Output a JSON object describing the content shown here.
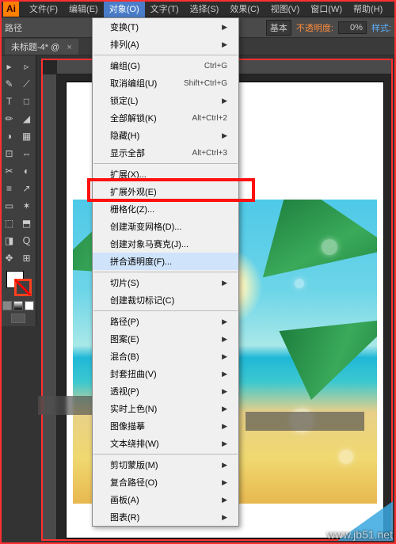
{
  "menubar": {
    "items": [
      "文件(F)",
      "编辑(E)",
      "对象(O)",
      "文字(T)",
      "选择(S)",
      "效果(C)",
      "视图(V)",
      "窗口(W)",
      "帮助(H)"
    ],
    "active_index": 2
  },
  "toolbar": {
    "path_label": "路径",
    "basic": "基本",
    "opacity_label": "不透明度:",
    "opacity_value": "0%",
    "style_label": "样式:"
  },
  "tab": {
    "title": "未标题-4*",
    "zoom": "@",
    "close": "×"
  },
  "dropdown": {
    "items": [
      {
        "label": "变换(T)",
        "arrow": true
      },
      {
        "label": "排列(A)",
        "arrow": true
      },
      {
        "sep": true
      },
      {
        "label": "编组(G)",
        "shortcut": "Ctrl+G"
      },
      {
        "label": "取消编组(U)",
        "shortcut": "Shift+Ctrl+G"
      },
      {
        "label": "锁定(L)",
        "arrow": true
      },
      {
        "label": "全部解锁(K)",
        "shortcut": "Alt+Ctrl+2"
      },
      {
        "label": "隐藏(H)",
        "arrow": true
      },
      {
        "label": "显示全部",
        "shortcut": "Alt+Ctrl+3"
      },
      {
        "sep": true
      },
      {
        "label": "扩展(X)..."
      },
      {
        "label": "扩展外观(E)"
      },
      {
        "label": "栅格化(Z)..."
      },
      {
        "label": "创建渐变网格(D)..."
      },
      {
        "label": "创建对象马赛克(J)..."
      },
      {
        "label": "拼合透明度(F)...",
        "highlight": true
      },
      {
        "sep": true
      },
      {
        "label": "切片(S)",
        "arrow": true
      },
      {
        "label": "创建裁切标记(C)"
      },
      {
        "sep": true
      },
      {
        "label": "路径(P)",
        "arrow": true
      },
      {
        "label": "图案(E)",
        "arrow": true
      },
      {
        "label": "混合(B)",
        "arrow": true
      },
      {
        "label": "封套扭曲(V)",
        "arrow": true
      },
      {
        "label": "透视(P)",
        "arrow": true
      },
      {
        "label": "实时上色(N)",
        "arrow": true
      },
      {
        "label": "图像描摹",
        "arrow": true
      },
      {
        "label": "文本绕排(W)",
        "arrow": true
      },
      {
        "sep": true
      },
      {
        "label": "剪切蒙版(M)",
        "arrow": true
      },
      {
        "label": "复合路径(O)",
        "arrow": true
      },
      {
        "label": "画板(A)",
        "arrow": true
      },
      {
        "label": "图表(R)",
        "arrow": true
      }
    ]
  },
  "tools": [
    "▸",
    "▹",
    "✎",
    "⟋",
    "T",
    "□",
    "✏",
    "◢",
    "◑",
    "▦",
    "⊡",
    "⇔",
    "✂",
    "◐",
    "≡",
    "↗",
    "▭",
    "✶",
    "⬚",
    "⬒",
    "◨",
    "Ｑ",
    "✥",
    "⊞"
  ],
  "watermark": "www.jb51.net",
  "logo": "Ai"
}
